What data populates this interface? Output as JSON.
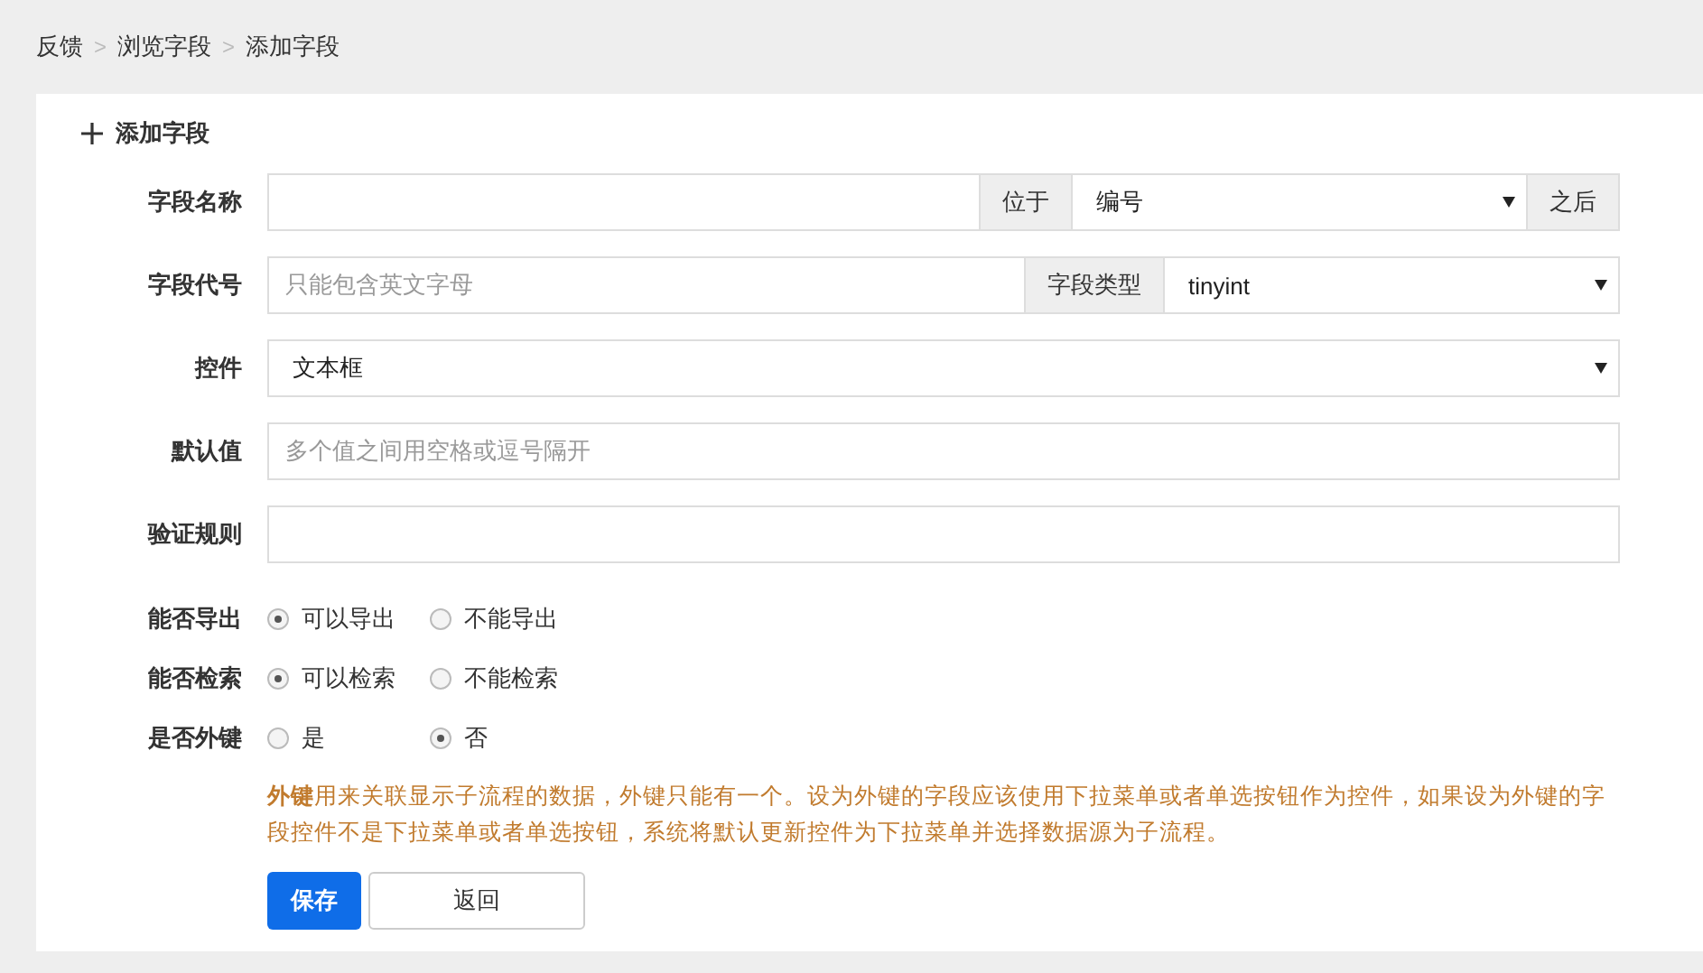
{
  "breadcrumb": [
    {
      "label": "反馈"
    },
    {
      "label": "浏览字段"
    },
    {
      "label": "添加字段"
    }
  ],
  "separator": ">",
  "panel_title": "添加字段",
  "rows": [
    {
      "label": "字段名称",
      "parts": [
        {
          "kind": "input"
        },
        {
          "kind": "addon",
          "text": "位于"
        },
        {
          "kind": "select",
          "value": "编号"
        },
        {
          "kind": "addon",
          "text": "之后"
        }
      ]
    },
    {
      "label": "字段代号",
      "parts": [
        {
          "kind": "input",
          "placeholder": "只能包含英文字母"
        },
        {
          "kind": "addon",
          "text": "字段类型"
        },
        {
          "kind": "select",
          "value": "tinyint"
        }
      ]
    },
    {
      "label": "控件",
      "parts": [
        {
          "kind": "select",
          "value": "文本框"
        }
      ]
    },
    {
      "label": "默认值",
      "parts": [
        {
          "kind": "input",
          "placeholder": "多个值之间用空格或逗号隔开"
        }
      ]
    },
    {
      "label": "验证规则",
      "parts": [
        {
          "kind": "input"
        }
      ]
    }
  ],
  "radio_groups": [
    {
      "label": "能否导出",
      "options": [
        {
          "label": "可以导出",
          "selected": true
        },
        {
          "label": "不能导出",
          "selected": false
        }
      ]
    },
    {
      "label": "能否检索",
      "options": [
        {
          "label": "可以检索",
          "selected": true
        },
        {
          "label": "不能检索",
          "selected": false
        }
      ]
    },
    {
      "label": "是否外键",
      "options": [
        {
          "label": "是",
          "selected": false
        },
        {
          "label": "否",
          "selected": true
        }
      ]
    }
  ],
  "note": "**外键**用来关联显示子流程的数据，外键只能有一个。设为外键的字段应该使用下拉菜单或者单选按钮作为控件，如果设为外键的字段控件不是下拉菜单或者单选按钮，系统将默认更新控件为下拉菜单并选择数据源为子流程。",
  "buttons": [
    {
      "label": "保存",
      "kind": "primary"
    },
    {
      "label": "返回",
      "kind": "default"
    }
  ]
}
